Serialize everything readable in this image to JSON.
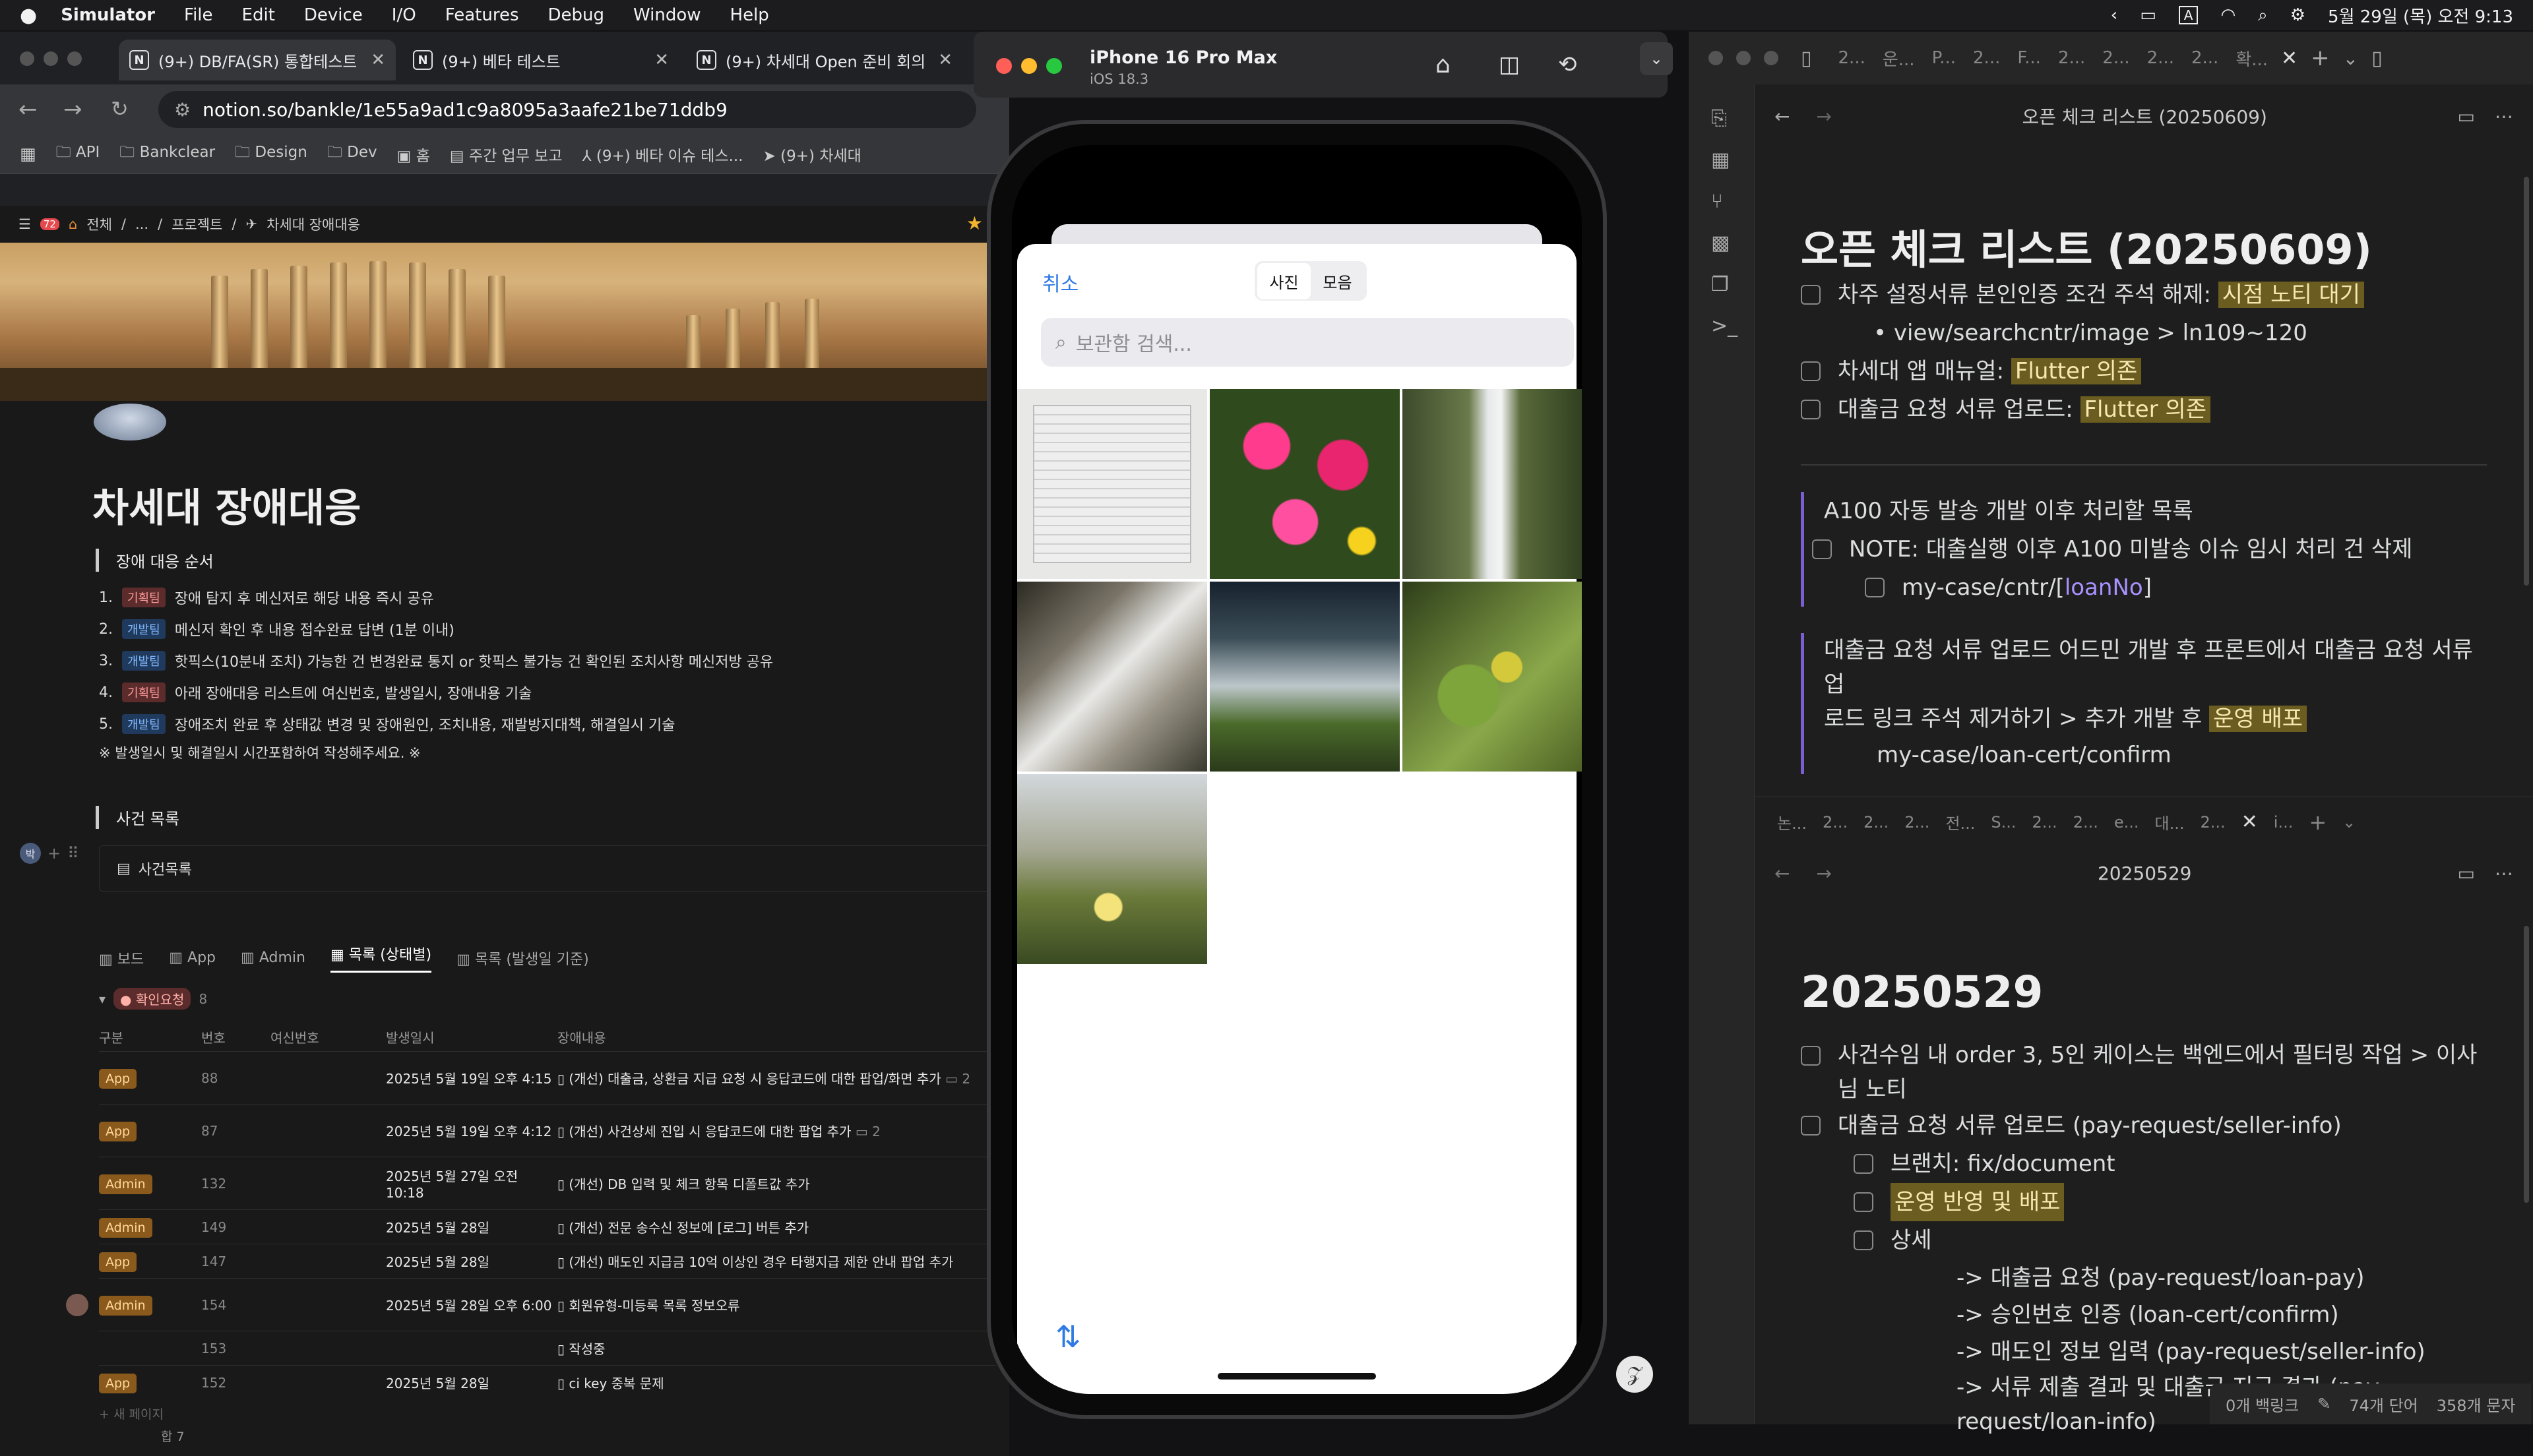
{
  "menubar": {
    "app": "Simulator",
    "items": [
      "File",
      "Edit",
      "Device",
      "I/O",
      "Features",
      "Debug",
      "Window",
      "Help"
    ],
    "datetime": "5월 29일 (목) 오전 9:13"
  },
  "chrome": {
    "tabs": [
      {
        "label": "(9+) DB/FA(SR) 통합테스트"
      },
      {
        "label": "(9+) 베타 테스트"
      },
      {
        "label": "(9+) 차세대 Open 준비 회의"
      }
    ],
    "url": "notion.so/bankle/1e55a9ad1c9a8095a3aafe21be71ddb9",
    "bookmarks": [
      "API",
      "Bankclear",
      "Design",
      "Dev",
      "홈",
      "주간 업무 보고",
      "(9+) 베타 이슈 테스...",
      "(9+) 차세대"
    ]
  },
  "notion": {
    "notif": "72",
    "breadcrumb": [
      "전체",
      "...",
      "프로젝트",
      "차세대 장애대응"
    ],
    "title": "차세대 장애대응",
    "quote1": "장애 대응 순서",
    "steps": [
      {
        "n": "1.",
        "tag": "기획팀",
        "type": "plan",
        "text": "장애 탐지 후 메신저로 해당 내용 즉시 공유"
      },
      {
        "n": "2.",
        "tag": "개발팀",
        "type": "dev",
        "text": "메신저 확인 후 내용 접수완료 답변 (1분 이내)"
      },
      {
        "n": "3.",
        "tag": "개발팀",
        "type": "dev",
        "text": "핫픽스(10분내 조치) 가능한 건 변경완료 통지 or 핫픽스 불가능 건 확인된 조치사항 메신저방 공유"
      },
      {
        "n": "4.",
        "tag": "기획팀",
        "type": "plan",
        "text": "아래 장애대응 리스트에 여신번호, 발생일시, 장애내용 기술"
      },
      {
        "n": "5.",
        "tag": "개발팀",
        "type": "dev",
        "text": "장애조치 완료 후 상태값 변경 및 장애원인, 조치내용, 재발방지대책, 해결일시 기술"
      }
    ],
    "note": "※ 발생일시 및 해결일시 시간포함하여 작성해주세요. ※",
    "quote2": "사건 목록",
    "db_title": "사건목록",
    "views": [
      "보드",
      "App",
      "Admin",
      "목록 (상태별)",
      "목록 (발생일 기준)"
    ],
    "group_label": "확인요청",
    "group_count": "8",
    "columns": [
      "구분",
      "번호",
      "여신번호",
      "발생일시",
      "장애내용"
    ],
    "rows": [
      {
        "badge": "App",
        "num": "88",
        "date": "2025년 5월 19일 오후 4:15",
        "text": "(개선) 대출금, 상환금 지급 요청 시 응답코드에 대한 팝업/화면 추가",
        "comments": "2"
      },
      {
        "badge": "App",
        "num": "87",
        "date": "2025년 5월 19일 오후 4:12",
        "text": "(개선) 사건상세 진입 시 응답코드에 대한 팝업 추가",
        "comments": "2"
      },
      {
        "badge": "Admin",
        "num": "132",
        "date": "2025년 5월 27일 오전 10:18",
        "text": "(개선) DB 입력 및 체크 항목 디폴트값 추가",
        "comments": ""
      },
      {
        "badge": "Admin",
        "num": "149",
        "date": "2025년 5월 28일",
        "text": "(개선) 전문 송수신 정보에 [로그] 버튼 추가",
        "comments": ""
      },
      {
        "badge": "App",
        "num": "147",
        "date": "2025년 5월 28일",
        "text": "(개선) 매도인 지급금 10억 이상인 경우 타행지급 제한 안내 팝업 추가",
        "comments": ""
      },
      {
        "badge": "Admin",
        "num": "154",
        "date": "2025년 5월 28일 오후 6:00",
        "text": "회원유형-미등록 목록 정보오류",
        "comments": ""
      },
      {
        "badge": "",
        "num": "153",
        "date": "",
        "text": "작성중",
        "comments": ""
      },
      {
        "badge": "App",
        "num": "152",
        "date": "2025년 5월 28일",
        "text": "ci key 중복 문제",
        "comments": ""
      }
    ],
    "new_page": "+ 새 페이지",
    "sum": "합 7"
  },
  "simulator": {
    "device": "iPhone 16 Pro Max",
    "os": "iOS 18.3",
    "cancel": "취소",
    "seg": [
      "사진",
      "모음"
    ],
    "search_placeholder": "보관함 검색..."
  },
  "obsidian": {
    "top_tabs": [
      "2...",
      "운...",
      "P...",
      "2...",
      "F...",
      "2...",
      "2...",
      "2...",
      "2...",
      "확..."
    ],
    "note1_title_bar": "오픈 체크 리스트 (20250609)",
    "note1_heading": "오픈 체크 리스트 (20250609)",
    "c1": "차주 설정서류 본인인증 조건 주석 해제:",
    "c1_hl": "시점 노티 대기",
    "c1_sub": "view/searchcntr/image > ln109~120",
    "c2": "차세대 앱 매뉴얼:",
    "c2_hl": "Flutter 의존",
    "c3": "대출금 요청 서류 업로드:",
    "c3_hl": "Flutter 의존",
    "b1": "A100 자동 발송 개발 이후 처리할 목록",
    "b1_c": "NOTE: 대출실행 이후 A100 미발송 이슈 임시 처리 건 삭제",
    "b1_sub_a": "my-case/cntr/[",
    "b1_sub_link": "loanNo",
    "b1_sub_b": "]",
    "b2_a": "대출금 요청 서류 업로드 어드민 개발 후 프론트에서 대출금 요청 서류 업",
    "b2_b": "로드 링크 주석 제거하기 > 추가 개발 후 ",
    "b2_hl": "운영 배포",
    "b2_sub": "my-case/loan-cert/confirm",
    "mid_tabs": [
      "논...",
      "2...",
      "2...",
      "2...",
      "전...",
      "S...",
      "2...",
      "2...",
      "e...",
      "대...",
      "2...",
      "i..."
    ],
    "note2_title_bar": "20250529",
    "note2_heading": "20250529",
    "d1a": "사건수임 내 order 3, 5인 케이스는 백엔드에서 필터링 작업 > 이사",
    "d1b": "님 노티",
    "d2": "대출금 요청 서류 업로드 (pay-request/seller-info)",
    "d2_s1": "브랜치: fix/document",
    "d2_s2": "운영 반영 및 배포",
    "d2_s3": "상세",
    "arrows": [
      "-> 대출금 요청 (pay-request/loan-pay)",
      "-> 승인번호 인증 (loan-cert/confirm)",
      "-> 매도인 정보 입력 (pay-request/seller-info)",
      "-> 서류 제출 결과 및 대출금 지급 결과 (pay-",
      "request/loan-info)"
    ],
    "status_backlinks": "0개 백링크",
    "status_words": "74개 단어",
    "status_chars": "358개 문자"
  }
}
